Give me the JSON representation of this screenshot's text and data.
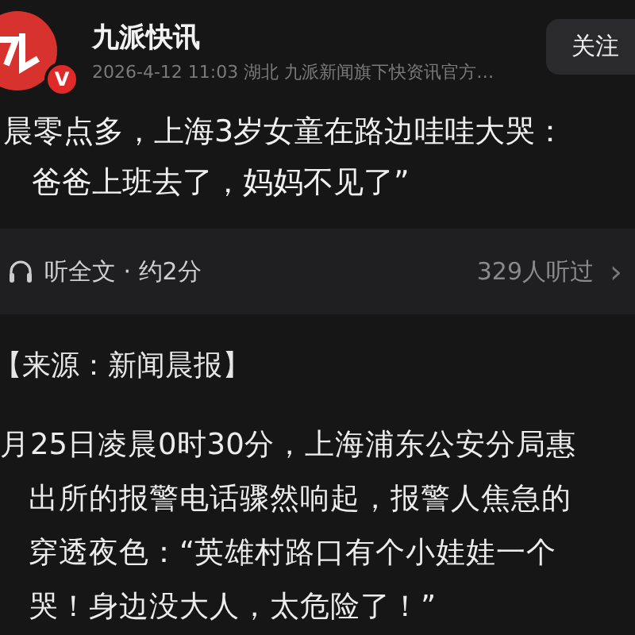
{
  "header": {
    "author": "九派快讯",
    "verified_badge": "V",
    "meta": "2026-4-12  11:03  湖北  九派新闻旗下快资讯官方…",
    "follow_button": "关注"
  },
  "headline": [
    "晨零点多，上海3岁女童在路边哇哇大哭：",
    "爸爸上班去了，妈妈不见了”"
  ],
  "listen_bar": {
    "label": "听全文 · 约2分",
    "listeners": "329人听过",
    "chevron": "›"
  },
  "source": "【来源：新闻晨报】",
  "body_lines": [
    "月25日凌晨0时30分，上海浦东公安分局惠",
    "出所的报警电话骤然响起，报警人焦急的",
    "穿透夜色：“英雄村路口有个小娃娃一个",
    "哭！身边没大人，太危险了！”"
  ]
}
